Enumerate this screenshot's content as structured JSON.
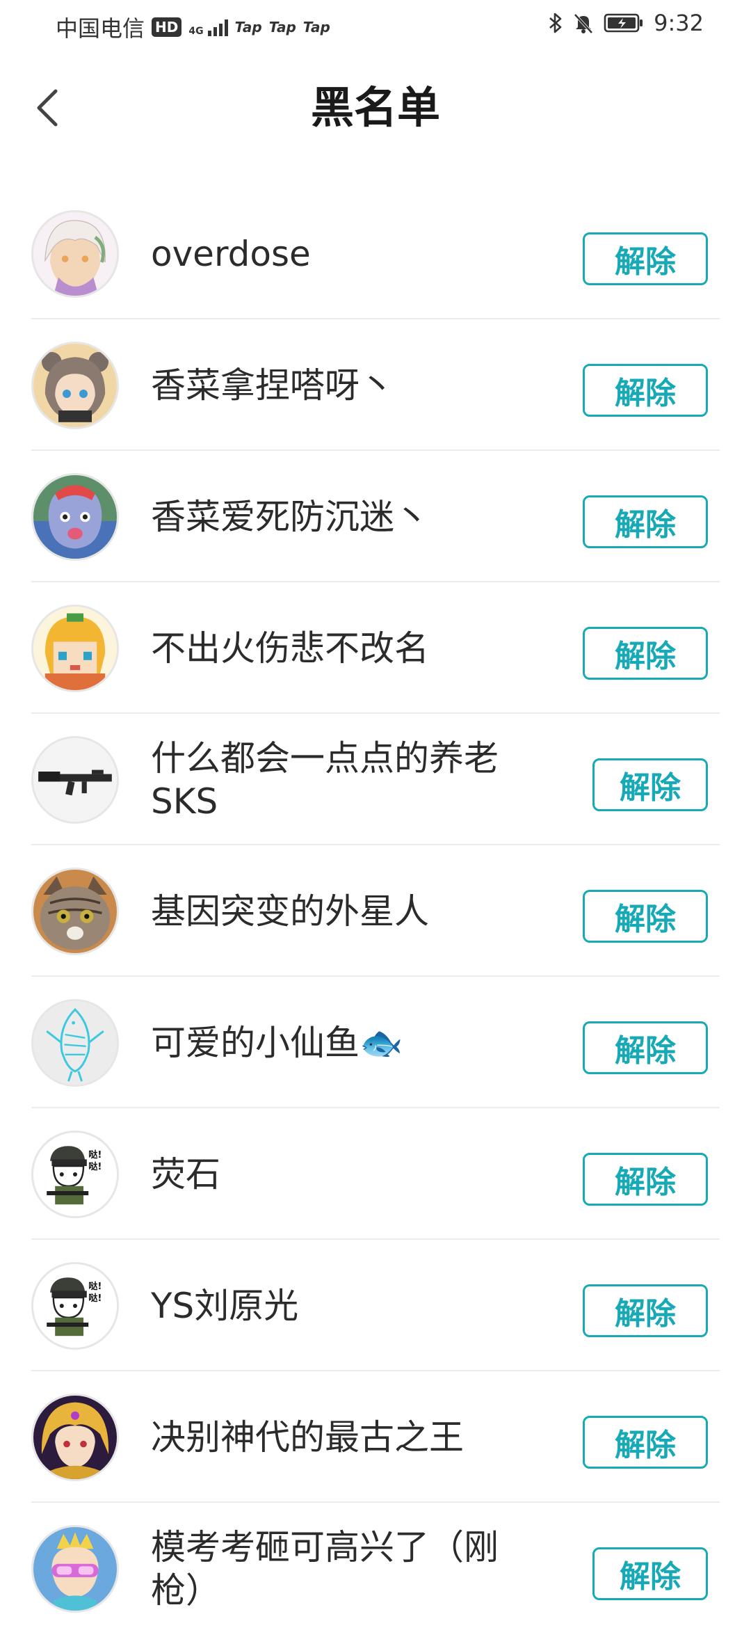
{
  "status_bar": {
    "carrier": "中国电信",
    "hd": "HD",
    "network": "4G",
    "apps": [
      "Tap",
      "Tap",
      "Tap"
    ],
    "time": "9:32"
  },
  "header": {
    "title": "黑名单",
    "back_icon": "chevron-left-icon"
  },
  "colors": {
    "accent": "#17a9b5",
    "divider": "#ececec",
    "text": "#2b2b2b"
  },
  "blacklist": [
    {
      "name": "overdose",
      "button": "解除",
      "avatar": "anime-girl-white-hair"
    },
    {
      "name": "香菜拿捏嗒呀丶",
      "button": "解除",
      "avatar": "anime-girl-bear-ears"
    },
    {
      "name": "香菜爱死防沉迷丶",
      "button": "解除",
      "avatar": "lion-dance-character"
    },
    {
      "name": "不出火伤悲不改名",
      "button": "解除",
      "avatar": "pixel-blonde-girl"
    },
    {
      "name": "什么都会一点点的养老SKS",
      "button": "解除",
      "avatar": "rifle"
    },
    {
      "name": "基因突变的外星人",
      "button": "解除",
      "avatar": "tabby-cat"
    },
    {
      "name": "可爱的小仙鱼🐟",
      "button": "解除",
      "avatar": "fish-doodle"
    },
    {
      "name": "荧石",
      "button": "解除",
      "avatar": "helmet-cat-meme"
    },
    {
      "name": "YS刘原光",
      "button": "解除",
      "avatar": "helmet-cat-meme"
    },
    {
      "name": "决别神代的最古之王",
      "button": "解除",
      "avatar": "golden-hair-king"
    },
    {
      "name": "模考考砸可高兴了（刚枪）",
      "button": "解除",
      "avatar": "cartoon-boy-goggles"
    }
  ]
}
